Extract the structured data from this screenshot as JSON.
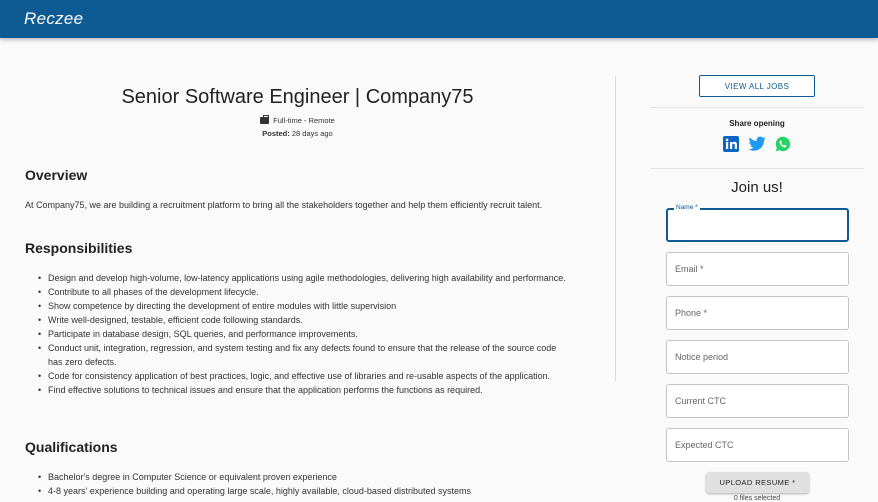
{
  "brand": {
    "logo": "Reczee",
    "bar_color": "#0e5a92"
  },
  "job": {
    "title": "Senior Software Engineer | Company75",
    "type": "Full-time - Remote",
    "posted_label": "Posted:",
    "posted_value": "28 days ago"
  },
  "overview": {
    "heading": "Overview",
    "text": "At Company75, we are building a recruitment platform to bring all the stakeholders together and help them efficiently recruit talent."
  },
  "responsibilities": {
    "heading": "Responsibilities",
    "items": [
      "Design and develop high-volume, low-latency applications using agile methodologies, delivering high availability and performance.",
      "Contribute to all phases of the development lifecycle.",
      "Show competence by directing the development of entire modules with little supervision",
      "Write well-designed, testable, efficient code following standards.",
      "Participate in database design, SQL queries, and performance improvements.",
      "Conduct unit, integration, regression, and system testing and fix any defects found to ensure that the release of the source code has zero defects.",
      "Code for consistency application of best practices, logic, and effective use of libraries and re-usable aspects of the application.",
      "Find effective solutions to technical issues and ensure that the application performs the functions as required."
    ]
  },
  "qualifications": {
    "heading": "Qualifications",
    "items": [
      "Bachelor's degree in Computer Science or equivalent proven experience",
      "4-8 years' experience building and operating large scale, highly available, cloud-based distributed systems"
    ]
  },
  "sidebar": {
    "view_all_jobs": "VIEW ALL JOBS",
    "share_label": "Share opening",
    "share_icons": [
      "linkedin-icon",
      "twitter-icon",
      "whatsapp-icon"
    ],
    "join_title": "Join us!",
    "fields": {
      "name": "Name *",
      "email": "Email *",
      "phone": "Phone *",
      "notice": "Notice period",
      "current_ctc": "Current CTC",
      "expected_ctc": "Expected CTC"
    },
    "upload_label": "UPLOAD RESUME *",
    "files_selected": "0 files selected"
  }
}
